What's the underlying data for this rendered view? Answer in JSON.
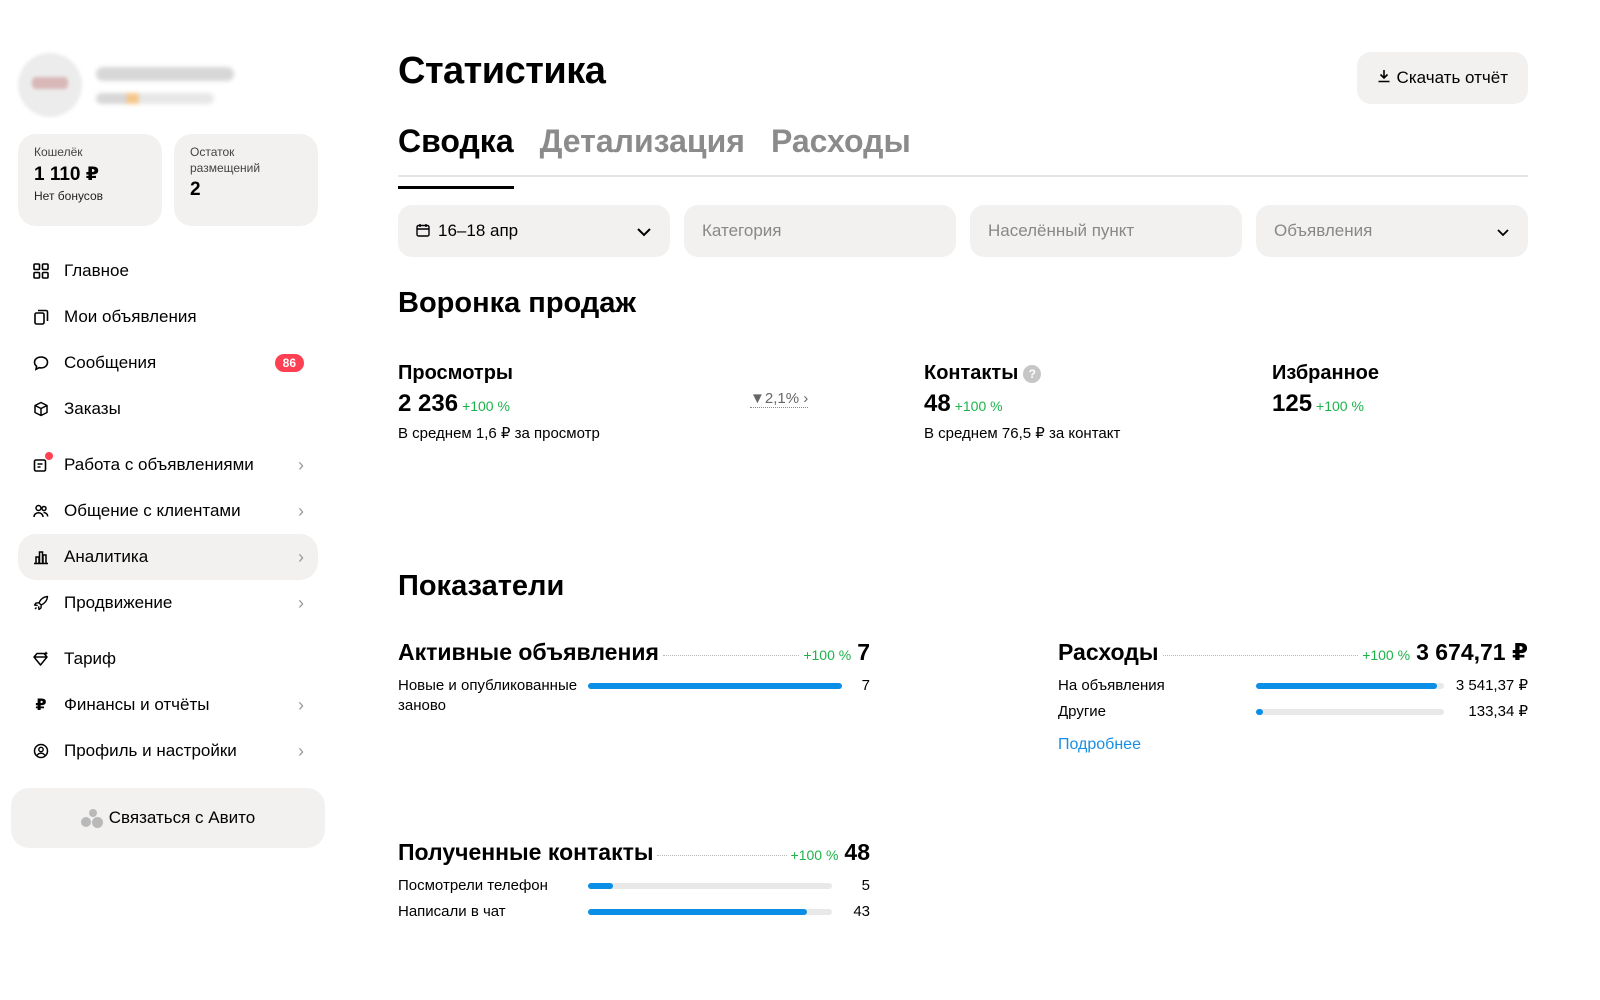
{
  "wallet": {
    "label": "Кошелёк",
    "value": "1 110 ₽",
    "sub": "Нет бонусов"
  },
  "remaining": {
    "label": "Остаток размещений",
    "value": "2"
  },
  "nav": {
    "main": "Главное",
    "my_ads": "Мои объявления",
    "messages": "Сообщения",
    "messages_badge": "86",
    "orders": "Заказы",
    "ads_work": "Работа с объявлениями",
    "clients": "Общение с клиентами",
    "analytics": "Аналитика",
    "promotion": "Продвижение",
    "tariff": "Тариф",
    "finance": "Финансы и отчёты",
    "profile": "Профиль и настройки"
  },
  "contact_button": "Связаться с Авито",
  "page_title": "Статистика",
  "download_button": "Скачать отчёт",
  "tabs": {
    "summary": "Сводка",
    "details": "Детализация",
    "expenses": "Расходы"
  },
  "filters": {
    "date": "16–18 апр",
    "category": "Категория",
    "locality": "Населённый пункт",
    "ads": "Объявления"
  },
  "funnel": {
    "title": "Воронка продаж",
    "views": {
      "name": "Просмотры",
      "value": "2 236",
      "growth": "+100 %",
      "sub": "В среднем 1,6 ₽ за просмотр"
    },
    "conversion": "2,1%",
    "contacts": {
      "name": "Контакты",
      "value": "48",
      "growth": "+100 %",
      "sub": "В среднем 76,5 ₽ за контакт"
    },
    "favorites": {
      "name": "Избранное",
      "value": "125",
      "growth": "+100 %"
    }
  },
  "indicators": {
    "title": "Показатели",
    "active_ads": {
      "name": "Активные объявления",
      "growth": "+100 %",
      "total": "7",
      "rows": [
        {
          "label": "Новые и опубликованные заново",
          "value": "7",
          "share": 1.0
        }
      ]
    },
    "expenses": {
      "name": "Расходы",
      "growth": "+100 %",
      "total": "3 674,71 ₽",
      "rows": [
        {
          "label": "На объявления",
          "value": "3 541,37 ₽",
          "share": 0.964
        },
        {
          "label": "Другие",
          "value": "133,34 ₽",
          "share": 0.036
        }
      ],
      "more_link": "Подробнее"
    },
    "contacts": {
      "name": "Полученные контакты",
      "growth": "+100 %",
      "total": "48",
      "rows": [
        {
          "label": "Посмотрели телефон",
          "value": "5",
          "share": 0.104
        },
        {
          "label": "Написали в чат",
          "value": "43",
          "share": 0.896
        }
      ]
    }
  }
}
